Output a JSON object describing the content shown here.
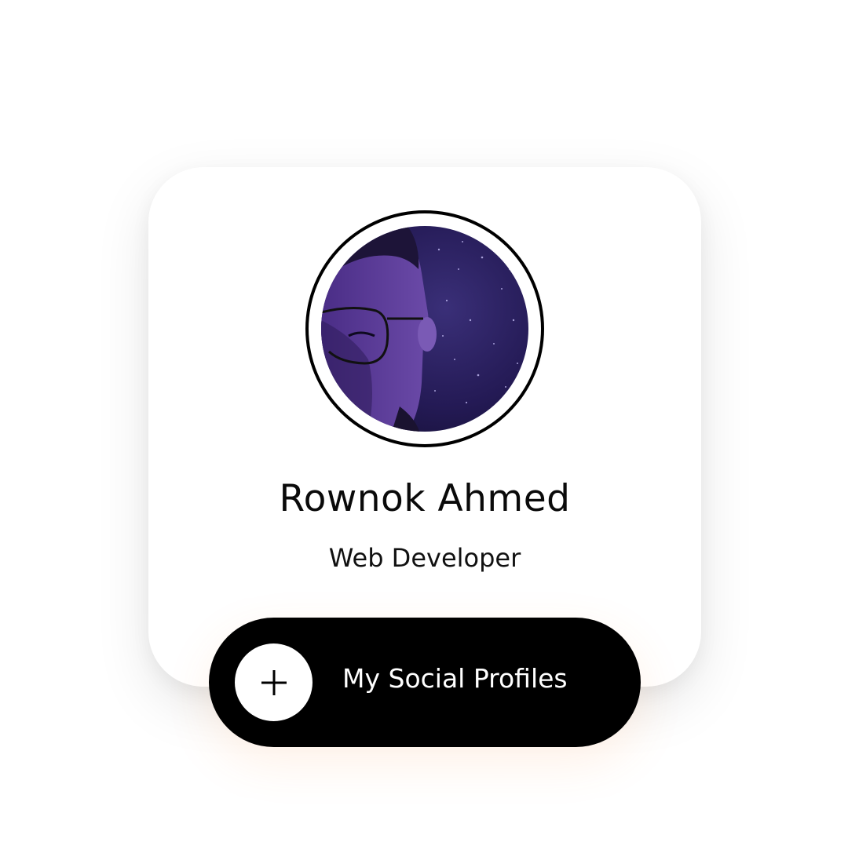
{
  "profile": {
    "name": "Rownok Ahmed",
    "role": "Web Developer"
  },
  "social_button": {
    "label": "My Social Profiles",
    "icon": "plus-icon"
  },
  "avatar": {
    "icon": "avatar-photo"
  },
  "colors": {
    "background": "#ffffff",
    "card": "#ffffff",
    "button": "#000000",
    "button_text": "#ffffff",
    "text": "#0a0a0a"
  }
}
